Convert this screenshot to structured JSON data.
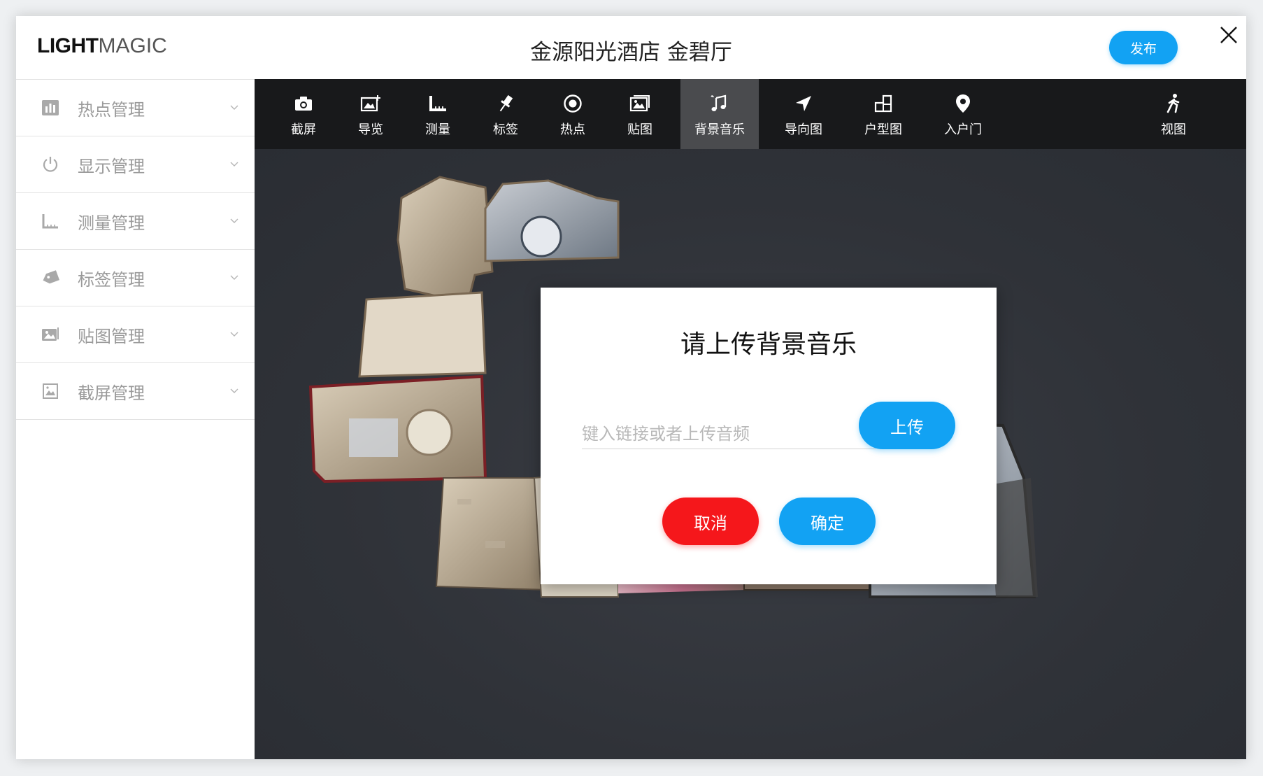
{
  "app": {
    "logo_bold": "LIGHT",
    "logo_thin": "MAGIC",
    "venue_title": "金源阳光酒店 金碧厅",
    "publish_label": "发布"
  },
  "sidebar": {
    "items": [
      {
        "label": "热点管理",
        "icon": "bar-chart-icon"
      },
      {
        "label": "显示管理",
        "icon": "power-icon"
      },
      {
        "label": "测量管理",
        "icon": "ruler-icon"
      },
      {
        "label": "标签管理",
        "icon": "tag-icon"
      },
      {
        "label": "贴图管理",
        "icon": "image-icon"
      },
      {
        "label": "截屏管理",
        "icon": "picture-frame-icon"
      }
    ]
  },
  "toolbar": {
    "tools": [
      {
        "label": "截屏",
        "icon": "camera-icon"
      },
      {
        "label": "导览",
        "icon": "image-add-icon"
      },
      {
        "label": "测量",
        "icon": "ruler-icon"
      },
      {
        "label": "标签",
        "icon": "pin-icon"
      },
      {
        "label": "热点",
        "icon": "hotspot-icon"
      },
      {
        "label": "贴图",
        "icon": "image-icon"
      },
      {
        "label": "背景音乐",
        "icon": "music-icon",
        "active": true
      },
      {
        "label": "导向图",
        "icon": "navigation-arrow-icon"
      },
      {
        "label": "户型图",
        "icon": "floorplan-icon"
      },
      {
        "label": "入户门",
        "icon": "location-pin-icon"
      },
      {
        "label": "视图",
        "icon": "walking-person-icon"
      }
    ]
  },
  "modal": {
    "title": "请上传背景音乐",
    "input_placeholder": "键入链接或者上传音频",
    "input_value": "",
    "upload_label": "上传",
    "cancel_label": "取消",
    "confirm_label": "确定"
  },
  "colors": {
    "accent": "#12a2f3",
    "danger": "#f5171b",
    "toolbar_bg": "#18191b",
    "toolbar_active": "#4a4b4e",
    "viewport_bg": "#2f3238",
    "sidebar_text": "#9a9a9a"
  }
}
